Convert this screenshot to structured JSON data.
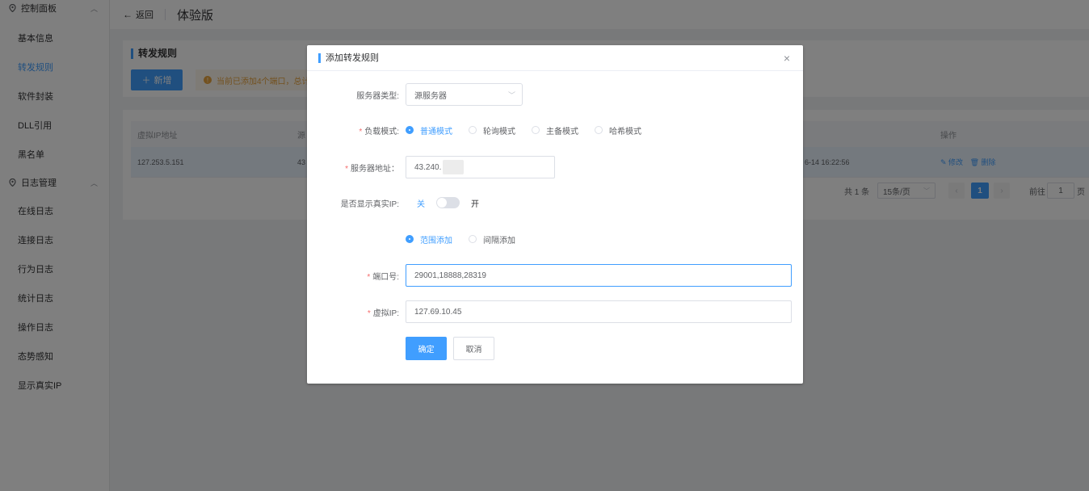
{
  "sidebar": {
    "group1": {
      "label": "控制面板"
    },
    "items1": [
      {
        "label": "基本信息"
      },
      {
        "label": "转发规则",
        "active": true
      },
      {
        "label": "软件封装"
      },
      {
        "label": "DLL引用"
      },
      {
        "label": "黑名单"
      }
    ],
    "group2": {
      "label": "日志管理"
    },
    "items2": [
      {
        "label": "在线日志"
      },
      {
        "label": "连接日志"
      },
      {
        "label": "行为日志"
      },
      {
        "label": "统计日志"
      },
      {
        "label": "操作日志"
      },
      {
        "label": "态势感知"
      },
      {
        "label": "显示真实IP"
      }
    ]
  },
  "topbar": {
    "back_label": "返回",
    "title": "体验版"
  },
  "page": {
    "panel_title": "转发规则",
    "new_button": "新增",
    "alert_text": "当前已添加4个端口，总计",
    "table": {
      "headers": [
        "虚拟IP地址",
        "源",
        "操作"
      ],
      "row": {
        "ip": "127.253.5.151",
        "src": "43",
        "time": "6-14 16:22:56",
        "edit": "修改",
        "delete": "删除"
      }
    },
    "pager": {
      "total": "共 1 条",
      "page_size": "15条/页",
      "current": "1",
      "goto_prefix": "前往",
      "goto_value": "1",
      "goto_suffix": "页"
    }
  },
  "dialog": {
    "title": "添加转发规则",
    "server_type": {
      "label": "服务器类型:",
      "value": "源服务器"
    },
    "load_mode": {
      "label": "负载模式:",
      "options": [
        "普通模式",
        "轮询模式",
        "主备模式",
        "哈希模式"
      ],
      "selected": 0
    },
    "server_addr": {
      "label": "服务器地址：",
      "value": "43.240."
    },
    "show_real_ip": {
      "label": "是否显示真实IP:",
      "off": "关",
      "on": "开",
      "enabled": false
    },
    "add_mode": {
      "options": [
        "范围添加",
        "间隔添加"
      ],
      "selected": 0
    },
    "port": {
      "label": "端口号:",
      "value": "29001,18888,28319"
    },
    "virtual_ip": {
      "label": "虚拟IP:",
      "value": "127.69.10.45"
    },
    "confirm": "确定",
    "cancel": "取消"
  },
  "colors": {
    "primary": "#409eff",
    "required": "#f56c6c",
    "warning": "#e6a23c"
  }
}
